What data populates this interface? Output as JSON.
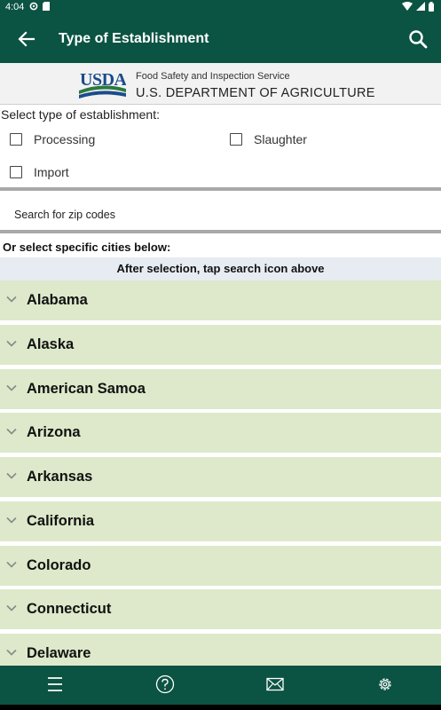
{
  "status": {
    "time": "4:04"
  },
  "appbar": {
    "title": "Type of Establishment"
  },
  "banner": {
    "agency": "Food Safety and Inspection Service",
    "department": "U.S. DEPARTMENT OF AGRICULTURE",
    "logo_text": "USDA"
  },
  "establishment": {
    "label": "Select type of establishment:",
    "options": [
      "Processing",
      "Slaughter",
      "Import"
    ]
  },
  "zip": {
    "placeholder": "Search for zip codes"
  },
  "cities": {
    "label": "Or select specific cities below:",
    "hint": "After selection, tap search icon above"
  },
  "states": [
    "Alabama",
    "Alaska",
    "American Samoa",
    "Arizona",
    "Arkansas",
    "California",
    "Colorado",
    "Connecticut",
    "Delaware"
  ],
  "colors": {
    "primary": "#0b5343",
    "state_row": "#dde9ca",
    "hint_bg": "#e7ecf3"
  },
  "icons": {
    "appbar": [
      "back-arrow-icon",
      "search-icon"
    ],
    "bottom": [
      "menu-icon",
      "help-icon",
      "mail-icon",
      "settings-icon"
    ]
  }
}
